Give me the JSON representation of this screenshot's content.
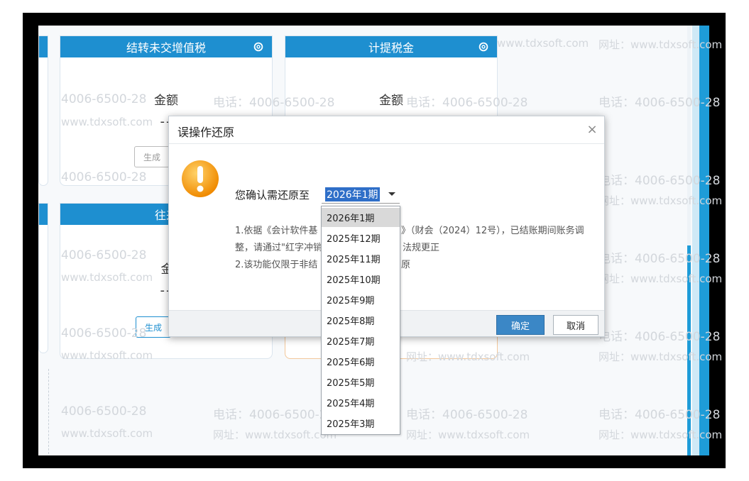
{
  "cards": [
    {
      "title": "结转未交增值税",
      "amount_label": "金额",
      "value": "--",
      "button": "生成"
    },
    {
      "title": "计提税金",
      "amount_label": "金额",
      "value": "--"
    },
    {
      "title": "往来",
      "amount_label": "金",
      "value": "--",
      "button": "生成"
    }
  ],
  "watermarks": {
    "phone": "电话：4006-6500-28",
    "phone_partial": "4006-6500-28",
    "site": "网址：www.tdxsoft.com",
    "site_partial": "www.tdxsoft.com"
  },
  "dialog": {
    "title": "误操作还原",
    "close_glyph": "×",
    "confirm_label": "您确认需还原至",
    "selected_period": "2026年1期",
    "note1a": "1.依据《会计软件基",
    "note1b": "》（财会（2024）12号），已结账期间账务调",
    "note2a": "整，请通过\"红字冲销",
    "note2b": "法规更正",
    "note3a": "2.该功能仅限于非结",
    "note3b": "原",
    "ok": "确定",
    "cancel": "取消"
  },
  "dropdown": {
    "options": [
      "2026年1期",
      "2025年12期",
      "2025年11期",
      "2025年10期",
      "2025年9期",
      "2025年8期",
      "2025年7期",
      "2025年6期",
      "2025年5期",
      "2025年4期",
      "2025年3期"
    ],
    "selected_index": 0
  },
  "colors": {
    "accent": "#1e8fd0",
    "ok_button": "#3b87c6",
    "warning": "#f5a623"
  }
}
